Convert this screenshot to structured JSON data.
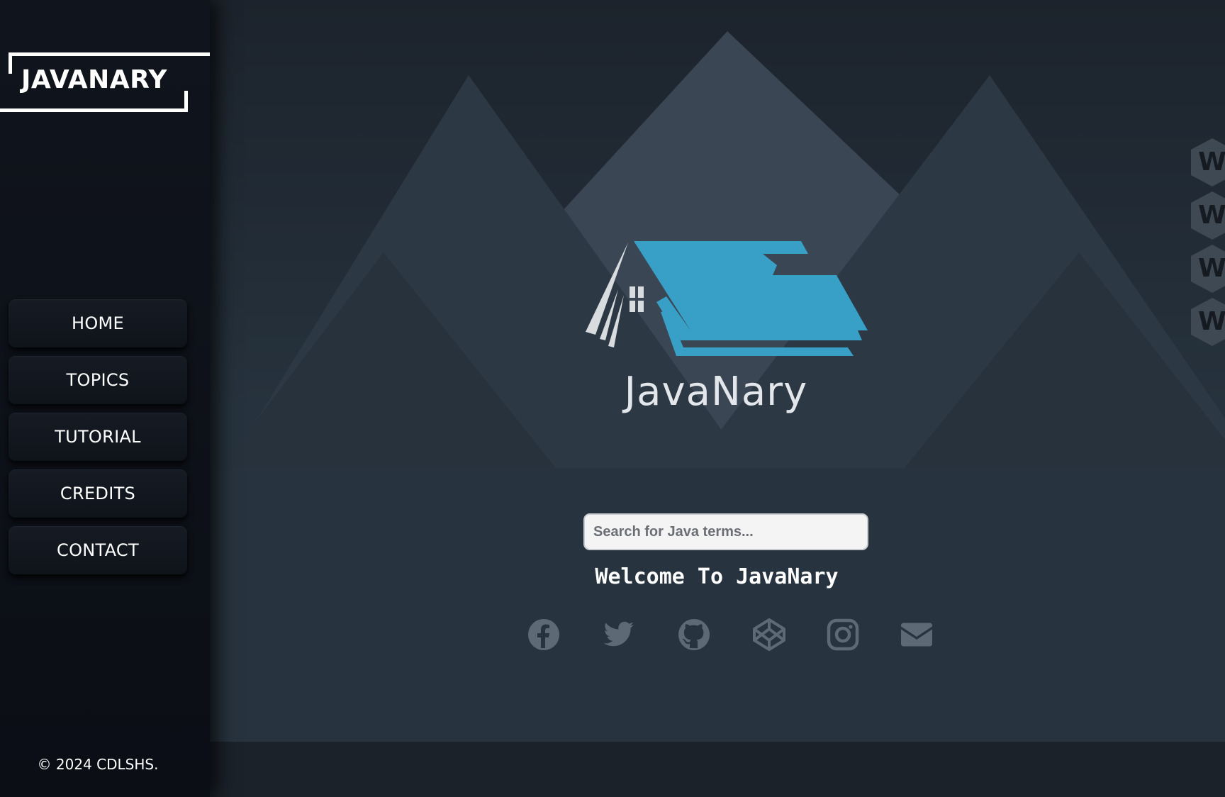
{
  "sidebar": {
    "logo": "JAVANARY",
    "nav": [
      {
        "label": "HOME"
      },
      {
        "label": "TOPICS"
      },
      {
        "label": "TUTORIAL"
      },
      {
        "label": "CREDITS"
      },
      {
        "label": "CONTACT"
      }
    ],
    "copyright": "© 2024 CDLSHS."
  },
  "main": {
    "brand_name": "JavaNary",
    "search_placeholder": "Search for Java terms...",
    "welcome": "Welcome To JavaNary",
    "side_badges": [
      "W",
      "W",
      "W",
      "W"
    ],
    "socials": [
      {
        "icon": "facebook-icon"
      },
      {
        "icon": "twitter-icon"
      },
      {
        "icon": "github-icon"
      },
      {
        "icon": "codepen-icon"
      },
      {
        "icon": "instagram-icon"
      },
      {
        "icon": "envelope-icon"
      }
    ]
  },
  "colors": {
    "accent": "#389fc6",
    "sidebar_bg": "#0e121a",
    "main_bg": "#26323d",
    "social_icon": "#5d6a76"
  }
}
